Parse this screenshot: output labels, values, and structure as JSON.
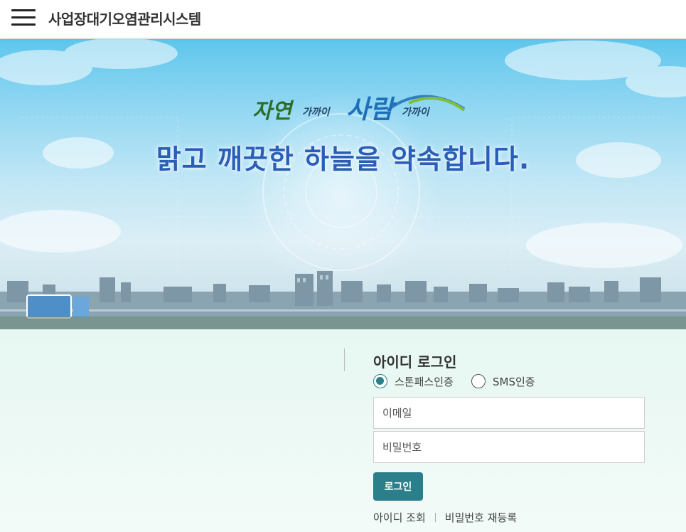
{
  "header": {
    "title": "사업장대기오염관리시스템",
    "menu_icon": "hamburger-menu-icon"
  },
  "hero": {
    "logo_words": [
      "자연",
      "가까이",
      "사람",
      "가까이"
    ],
    "slogan": "맑고 깨끗한 하늘을 약속합니다."
  },
  "login": {
    "title": "아이디 로그인",
    "auth_options": [
      {
        "label": "스톤패스인증",
        "selected": true
      },
      {
        "label": "SMS인증",
        "selected": false
      }
    ],
    "email_placeholder": "이메일",
    "password_placeholder": "비밀번호",
    "login_button": "로그인",
    "links": [
      "아이디 조회",
      "비밀번호 재등록"
    ]
  },
  "colors": {
    "accent": "#2a7f8a",
    "slogan": "#2a5fb8"
  }
}
